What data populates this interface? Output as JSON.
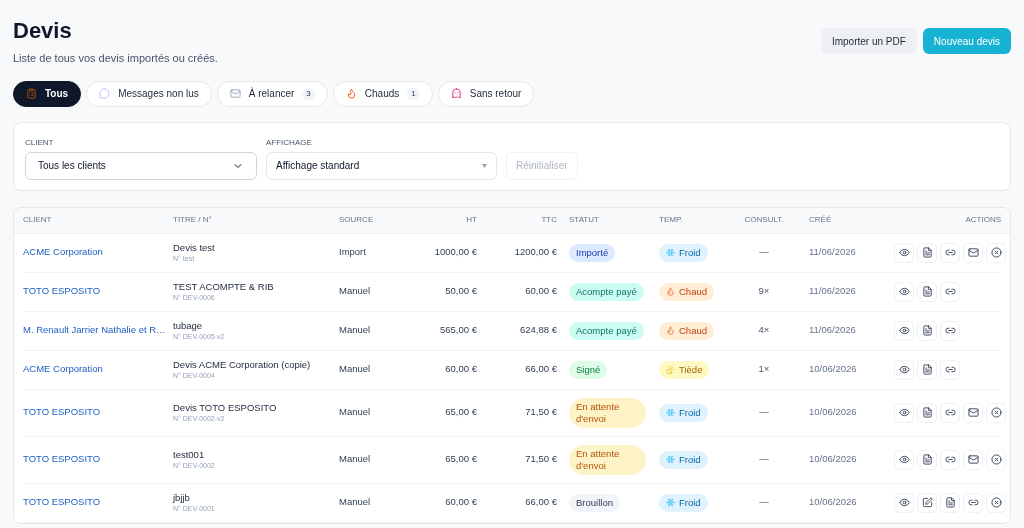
{
  "header": {
    "title": "Devis",
    "subtitle": "Liste de tous vos devis importés ou créés.",
    "buttons": [
      {
        "label": "Importer un PDF",
        "kind": "secondary"
      },
      {
        "label": "Nouveau devis",
        "kind": "primary"
      }
    ]
  },
  "tabs": [
    {
      "label": "Tous",
      "kind": "all",
      "selected": true
    },
    {
      "label": "Messages non lus",
      "kind": "unread",
      "selected": false
    },
    {
      "label": "À relancer",
      "kind": "followup",
      "count": "3",
      "selected": false
    },
    {
      "label": "Chauds",
      "kind": "hot",
      "count": "1",
      "selected": false
    },
    {
      "label": "Sans retour",
      "kind": "noreply",
      "selected": false
    }
  ],
  "filters": {
    "client": {
      "label": "CLIENT",
      "value": "Tous les clients"
    },
    "display": {
      "label": "AFFICHAGE",
      "value": "Affichage standard"
    },
    "reset": {
      "label": "Réinitialiser",
      "disabled": true
    }
  },
  "table": {
    "columns": [
      "CLIENT",
      "TITRE / N°",
      "SOURCE",
      "HT",
      "TTC",
      "STATUT",
      "TEMP.",
      "CONSULT.",
      "CRÉÉ",
      "ACTIONS"
    ],
    "rows": [
      {
        "client": "ACME Corporation",
        "title": "Devis test",
        "number": "N° test",
        "source": "Import",
        "ht": "1000,00 €",
        "ttc": "1200,00 €",
        "status": {
          "label": "Importé",
          "kind": "imported"
        },
        "temp": {
          "label": "Froid",
          "kind": "cold"
        },
        "views": "—",
        "created": "11/06/2026",
        "actions": [
          {
            "kind": "view"
          },
          {
            "kind": "pdf"
          },
          {
            "kind": "link"
          },
          {
            "kind": "mail"
          },
          {
            "kind": "cancel"
          }
        ]
      },
      {
        "client": "TOTO ESPOSITO",
        "title": "TEST ACOMPTE & RIB",
        "number": "N° DEV-0006",
        "source": "Manuel",
        "ht": "50,00 €",
        "ttc": "60,00 €",
        "status": {
          "label": "Acompte payé",
          "kind": "paid"
        },
        "temp": {
          "label": "Chaud",
          "kind": "hot"
        },
        "views": "9×",
        "created": "11/06/2026",
        "actions": [
          {
            "kind": "view"
          },
          {
            "kind": "pdf"
          },
          {
            "kind": "link"
          }
        ]
      },
      {
        "client": "M. Renault Jarrier Nathalie et R…",
        "title": "tubage",
        "number": "N° DEV-0005-v2",
        "source": "Manuel",
        "ht": "565,00 €",
        "ttc": "624,88 €",
        "status": {
          "label": "Acompte payé",
          "kind": "paid"
        },
        "temp": {
          "label": "Chaud",
          "kind": "hot"
        },
        "views": "4×",
        "created": "11/06/2026",
        "actions": [
          {
            "kind": "view"
          },
          {
            "kind": "pdf"
          },
          {
            "kind": "link"
          }
        ]
      },
      {
        "client": "ACME Corporation",
        "title": "Devis ACME Corporation (copie)",
        "number": "N° DEV-0004",
        "source": "Manuel",
        "ht": "60,00 €",
        "ttc": "66,00 €",
        "status": {
          "label": "Signé",
          "kind": "signed"
        },
        "temp": {
          "label": "Tiède",
          "kind": "warm"
        },
        "views": "1×",
        "created": "10/06/2026",
        "actions": [
          {
            "kind": "view"
          },
          {
            "kind": "pdf"
          },
          {
            "kind": "link"
          }
        ]
      },
      {
        "client": "TOTO ESPOSITO",
        "title": "Devis TOTO ESPOSITO",
        "number": "N° DEV-0002-v2",
        "source": "Manuel",
        "ht": "65,00 €",
        "ttc": "71,50 €",
        "status": {
          "label": "En attente d'envoi",
          "kind": "pending"
        },
        "temp": {
          "label": "Froid",
          "kind": "cold"
        },
        "views": "—",
        "created": "10/06/2026",
        "actions": [
          {
            "kind": "view"
          },
          {
            "kind": "pdf"
          },
          {
            "kind": "link"
          },
          {
            "kind": "mail"
          },
          {
            "kind": "cancel"
          }
        ]
      },
      {
        "client": "TOTO ESPOSITO",
        "title": "test001",
        "number": "N° DEV-0002",
        "source": "Manuel",
        "ht": "65,00 €",
        "ttc": "71,50 €",
        "status": {
          "label": "En attente d'envoi",
          "kind": "pending"
        },
        "temp": {
          "label": "Froid",
          "kind": "cold"
        },
        "views": "—",
        "created": "10/06/2026",
        "actions": [
          {
            "kind": "view"
          },
          {
            "kind": "pdf"
          },
          {
            "kind": "link"
          },
          {
            "kind": "mail"
          },
          {
            "kind": "cancel"
          }
        ]
      },
      {
        "client": "TOTO ESPOSITO",
        "title": "jbjjb",
        "number": "N° DEV-0001",
        "source": "Manuel",
        "ht": "60,00 €",
        "ttc": "66,00 €",
        "status": {
          "label": "Brouillon",
          "kind": "draft"
        },
        "temp": {
          "label": "Froid",
          "kind": "cold"
        },
        "views": "—",
        "created": "10/06/2026",
        "actions": [
          {
            "kind": "view"
          },
          {
            "kind": "edit"
          },
          {
            "kind": "pdf"
          },
          {
            "kind": "link"
          },
          {
            "kind": "cancel"
          }
        ]
      }
    ]
  }
}
